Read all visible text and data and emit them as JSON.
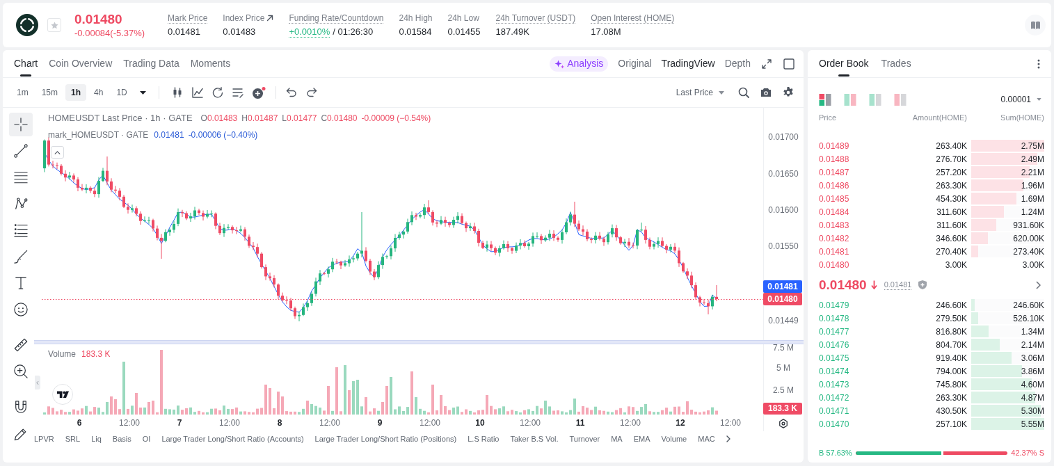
{
  "header": {
    "price": "0.01480",
    "change": "-0.00084(-5.37%)",
    "starred": false,
    "stats": [
      {
        "kind": "plain",
        "label": "Mark Price",
        "value": "0.01481",
        "tooltip": true
      },
      {
        "kind": "link",
        "label": "Index Price",
        "value": "0.01483",
        "tooltip": false
      },
      {
        "kind": "funding",
        "label": "Funding Rate/Countdown",
        "rate": "+0.0010%",
        "countdown": "/ 01:26:30",
        "tooltip": true
      },
      {
        "kind": "plain",
        "label": "24h High",
        "value": "0.01584",
        "tooltip": false
      },
      {
        "kind": "plain",
        "label": "24h Low",
        "value": "0.01455",
        "tooltip": false
      },
      {
        "kind": "plain",
        "label": "24h Turnover (USDT)",
        "value": "187.49K",
        "tooltip": true
      },
      {
        "kind": "plain",
        "label": "Open Interest (HOME)",
        "value": "17.08M",
        "tooltip": true
      }
    ]
  },
  "chart_panel": {
    "tabs": [
      {
        "label": "Chart",
        "selected": true
      },
      {
        "label": "Coin Overview",
        "selected": false
      },
      {
        "label": "Trading Data",
        "selected": false
      },
      {
        "label": "Moments",
        "selected": false
      }
    ],
    "analysis_button": "Analysis",
    "views": [
      {
        "label": "Original",
        "selected": false
      },
      {
        "label": "TradingView",
        "selected": true
      },
      {
        "label": "Depth",
        "selected": false
      }
    ],
    "intervals": [
      {
        "label": "1m",
        "selected": false
      },
      {
        "label": "15m",
        "selected": false
      },
      {
        "label": "1h",
        "selected": true
      },
      {
        "label": "4h",
        "selected": false
      },
      {
        "label": "1D",
        "selected": false
      }
    ],
    "price_source": "Last Price",
    "tools": [
      {
        "selected": true
      },
      {
        "selected": false
      },
      {
        "selected": false
      },
      {
        "selected": false
      },
      {
        "selected": false
      },
      {
        "selected": false
      },
      {
        "selected": false
      },
      {
        "selected": false
      },
      {
        "selected": false
      },
      {
        "selected": false
      },
      {
        "selected": false
      },
      {
        "selected": false
      }
    ],
    "legend": {
      "title": "HOMEUSDT Last Price · 1h · GATE",
      "ohlc": [
        {
          "key": "O",
          "value": "0.01483"
        },
        {
          "key": "H",
          "value": "0.01487"
        },
        {
          "key": "L",
          "value": "0.01477"
        },
        {
          "key": "C",
          "value": "0.01480"
        }
      ],
      "change": "-0.00009 (−0.54%)"
    },
    "mark_legend": {
      "title": "mark_HOMEUSDT · GATE",
      "value": "0.01481",
      "change": "-0.00006 (−0.40%)"
    },
    "price_axis": [
      "0.01700",
      "0.01650",
      "0.01600",
      "0.01550",
      "0.01449"
    ],
    "price_tags": [
      {
        "kind": "mark",
        "value": "0.01481"
      },
      {
        "kind": "last",
        "value": "0.01480"
      }
    ],
    "volume_legend": {
      "label": "Volume",
      "value": "183.3 K"
    },
    "volume_axis": [
      "7.5 M",
      "5 M",
      "2.5 M"
    ],
    "volume_tag": "183.3 K",
    "time_axis": [
      {
        "kind": "day",
        "label": "6"
      },
      {
        "kind": "time",
        "label": "12:00"
      },
      {
        "kind": "day",
        "label": "7"
      },
      {
        "kind": "time",
        "label": "12:00"
      },
      {
        "kind": "day",
        "label": "8"
      },
      {
        "kind": "time",
        "label": "12:00"
      },
      {
        "kind": "day",
        "label": "9"
      },
      {
        "kind": "time",
        "label": "12:00"
      },
      {
        "kind": "day",
        "label": "10"
      },
      {
        "kind": "time",
        "label": "12:00"
      },
      {
        "kind": "day",
        "label": "11"
      },
      {
        "kind": "time",
        "label": "12:00"
      },
      {
        "kind": "day",
        "label": "12"
      },
      {
        "kind": "time",
        "label": "12:00"
      }
    ],
    "indicators": [
      "LPVR",
      "SRL",
      "Liq",
      "Basis",
      "OI",
      "Large Trader Long/Short Ratio (Accounts)",
      "Large Trader Long/Short Ratio (Positions)",
      "L.S Ratio",
      "Taker B.S Vol.",
      "Turnover",
      "MA",
      "EMA",
      "Volume",
      "MAC"
    ]
  },
  "order_book": {
    "tabs": [
      {
        "label": "Order Book",
        "selected": true
      },
      {
        "label": "Trades",
        "selected": false
      }
    ],
    "layouts": [
      {
        "kind": "all",
        "selected": true
      },
      {
        "kind": "split",
        "selected": false
      },
      {
        "kind": "bids",
        "selected": false
      },
      {
        "kind": "asks",
        "selected": false
      }
    ],
    "precision": "0.00001",
    "columns": [
      "Price",
      "Amount(HOME)",
      "Sum(HOME)"
    ],
    "asks": [
      {
        "price": "0.01489",
        "amount": "263.40K",
        "sum": "2.75M",
        "level": 1
      },
      {
        "price": "0.01488",
        "amount": "276.70K",
        "sum": "2.49M",
        "level": 0.905
      },
      {
        "price": "0.01487",
        "amount": "257.20K",
        "sum": "2.21M",
        "level": 0.804
      },
      {
        "price": "0.01486",
        "amount": "263.30K",
        "sum": "1.96M",
        "level": 0.713
      },
      {
        "price": "0.01485",
        "amount": "454.30K",
        "sum": "1.69M",
        "level": 0.615
      },
      {
        "price": "0.01484",
        "amount": "311.60K",
        "sum": "1.24M",
        "level": 0.451
      },
      {
        "price": "0.01483",
        "amount": "311.60K",
        "sum": "931.60K",
        "level": 0.339
      },
      {
        "price": "0.01482",
        "amount": "346.60K",
        "sum": "620.00K",
        "level": 0.225
      },
      {
        "price": "0.01481",
        "amount": "270.40K",
        "sum": "273.40K",
        "level": 0.099
      },
      {
        "price": "0.01480",
        "amount": "3.00K",
        "sum": "3.00K"
      }
    ],
    "last_price": {
      "value": "0.01480",
      "falling": true,
      "mark": "0.01481"
    },
    "bids": [
      {
        "price": "0.01479",
        "amount": "246.60K",
        "sum": "246.60K",
        "level": 0.044
      },
      {
        "price": "0.01478",
        "amount": "279.50K",
        "sum": "526.10K",
        "level": 0.095
      },
      {
        "price": "0.01477",
        "amount": "816.80K",
        "sum": "1.34M",
        "level": 0.241
      },
      {
        "price": "0.01476",
        "amount": "804.70K",
        "sum": "2.14M",
        "level": 0.386
      },
      {
        "price": "0.01475",
        "amount": "919.40K",
        "sum": "3.06M",
        "level": 0.551
      },
      {
        "price": "0.01474",
        "amount": "794.00K",
        "sum": "3.86M",
        "level": 0.695
      },
      {
        "price": "0.01473",
        "amount": "745.80K",
        "sum": "4.60M",
        "level": 0.829
      },
      {
        "price": "0.01472",
        "amount": "263.30K",
        "sum": "4.87M",
        "level": 0.877
      },
      {
        "price": "0.01471",
        "amount": "430.50K",
        "sum": "5.30M",
        "level": 0.955
      },
      {
        "price": "0.01470",
        "amount": "257.10K",
        "sum": "5.55M",
        "level": 1
      }
    ],
    "ratio": {
      "buy": "B 57.63%",
      "sell": "42.37% S",
      "level": 0.5763
    }
  }
}
